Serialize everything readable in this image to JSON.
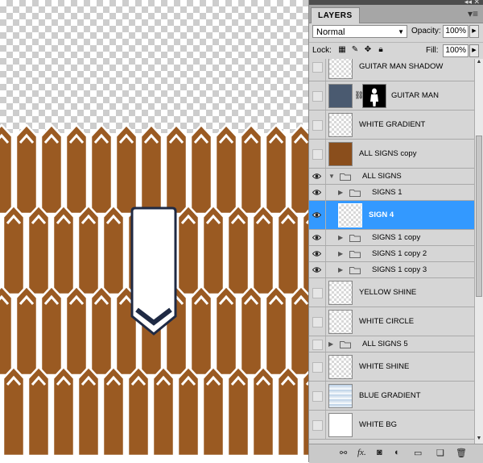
{
  "panel": {
    "tab_label": "LAYERS",
    "blend_mode": "Normal",
    "opacity_label": "Opacity:",
    "opacity_value": "100%",
    "lock_label": "Lock:",
    "fill_label": "Fill:",
    "fill_value": "100%"
  },
  "layers": [
    {
      "name": "GUITAR MAN SHADOW",
      "visible": false,
      "kind": "layer",
      "partial": true
    },
    {
      "name": "GUITAR MAN",
      "visible": false,
      "kind": "layer-mask"
    },
    {
      "name": "WHITE GRADIENT",
      "visible": false,
      "kind": "layer"
    },
    {
      "name": "ALL SIGNS copy",
      "visible": false,
      "kind": "layer-wood"
    },
    {
      "name": "ALL SIGNS",
      "visible": true,
      "kind": "group",
      "expanded": true
    },
    {
      "name": "SIGNS 1",
      "visible": true,
      "kind": "group",
      "indent": true
    },
    {
      "name": "SIGN 4",
      "visible": true,
      "kind": "layer",
      "indent": true,
      "selected": true
    },
    {
      "name": "SIGNS 1 copy",
      "visible": true,
      "kind": "group",
      "indent": true
    },
    {
      "name": "SIGNS 1 copy 2",
      "visible": true,
      "kind": "group",
      "indent": true
    },
    {
      "name": "SIGNS 1 copy 3",
      "visible": true,
      "kind": "group",
      "indent": true
    },
    {
      "name": "YELLOW SHINE",
      "visible": false,
      "kind": "layer"
    },
    {
      "name": "WHITE CIRCLE",
      "visible": false,
      "kind": "layer"
    },
    {
      "name": "ALL SIGNS 5",
      "visible": false,
      "kind": "group"
    },
    {
      "name": "WHITE SHINE",
      "visible": false,
      "kind": "layer"
    },
    {
      "name": "BLUE GRADIENT",
      "visible": false,
      "kind": "layer-blue"
    },
    {
      "name": "WHITE BG",
      "visible": false,
      "kind": "layer-white"
    }
  ],
  "bottom_icons": [
    "link-layers-icon",
    "fx-icon",
    "add-mask-icon",
    "adjustment-layer-icon",
    "new-group-icon",
    "new-layer-icon",
    "trash-icon"
  ],
  "bottom_glyphs": {
    "fx": "fx."
  },
  "colors": {
    "wood": "#9a5a22",
    "selection": "#3399ff",
    "sign_white": "#ffffff",
    "sign_outline": "#1f2a44"
  }
}
